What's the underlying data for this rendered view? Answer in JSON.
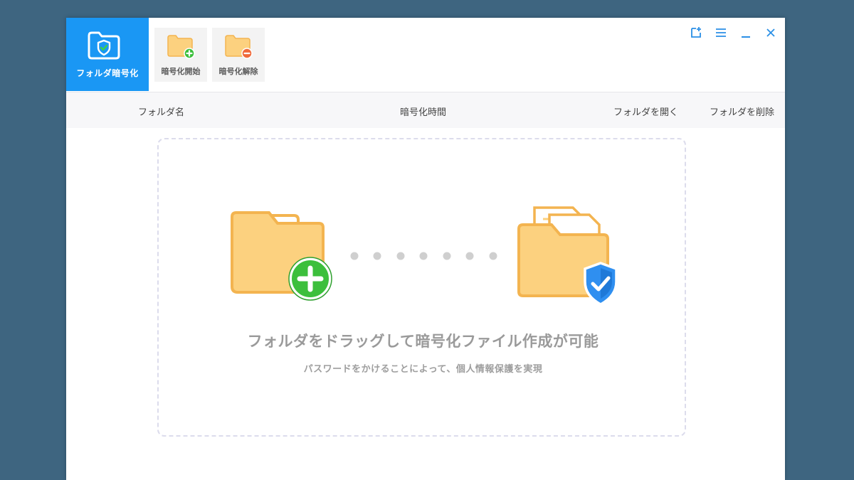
{
  "sidebar": {
    "brand_label": "フォルダ暗号化",
    "brand_icon": "shield-folder-icon"
  },
  "toolbar": {
    "start_label": "暗号化開始",
    "start_icon": "folder-add-icon",
    "remove_label": "暗号化解除",
    "remove_icon": "folder-remove-icon"
  },
  "window_controls": [
    "feedback-icon",
    "menu-icon",
    "minimize-icon",
    "close-icon"
  ],
  "table": {
    "columns": [
      "フォルダ名",
      "暗号化時間",
      "フォルダを開く",
      "フォルダを削除"
    ]
  },
  "dropzone": {
    "title": "フォルダをドラッグして暗号化ファイル作成が可能",
    "subtitle": "パスワードをかけることによって、個人情報保護を実現"
  },
  "colors": {
    "accent": "#1a97f4",
    "background": "#3e6580",
    "folder": "#fcd17f",
    "folder_outline": "#f3b450",
    "add_green": "#3cbf3c",
    "remove_red": "#f06a3b",
    "shield_blue": "#2f8ff0"
  }
}
